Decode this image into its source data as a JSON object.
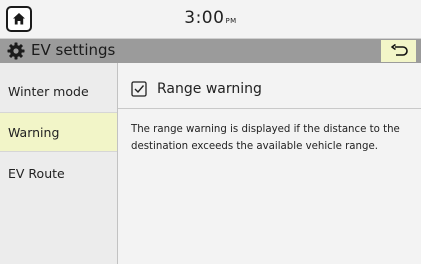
{
  "status_bar": {
    "time": "3:00",
    "ampm": "PM"
  },
  "header": {
    "title": "EV settings"
  },
  "sidebar": {
    "items": [
      {
        "label": "Winter mode"
      },
      {
        "label": "Warning"
      },
      {
        "label": "EV Route"
      }
    ]
  },
  "content": {
    "option_label": "Range warning",
    "option_checked": true,
    "description": "The range warning is displayed if the distance to the destination exceeds the available vehicle range."
  },
  "icons": {
    "home": "home-icon",
    "gear": "gear-icon",
    "back": "back-arrow-icon",
    "checkbox": "checkbox-checked-icon"
  },
  "colors": {
    "titlebar": "#9b9b9b",
    "active_item": "#f2f5c8",
    "background": "#f3f3f3"
  }
}
